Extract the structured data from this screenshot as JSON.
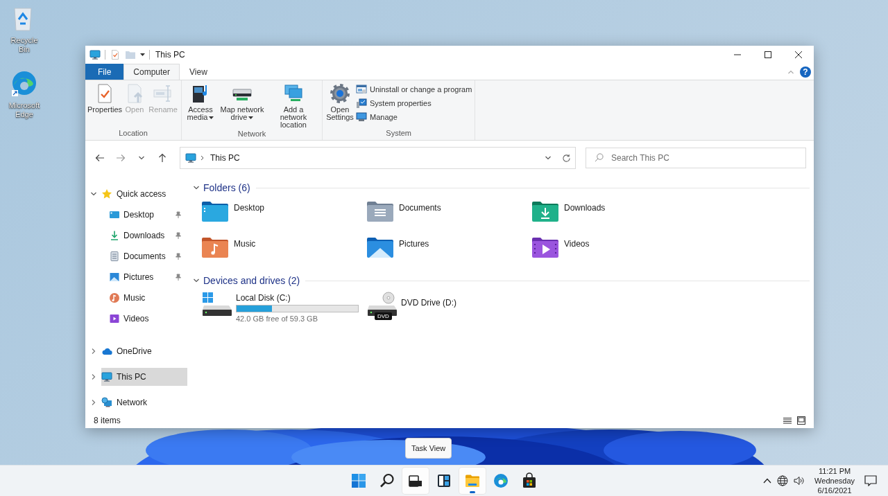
{
  "desktop_icons": [
    {
      "kind": "recycle_bin",
      "label": "Recycle Bin"
    },
    {
      "kind": "edge",
      "label": "Microsoft Edge"
    }
  ],
  "window": {
    "title": "This PC",
    "help": "?",
    "ribbon_tabs": [
      {
        "label": "File",
        "kind": "file",
        "selected": false
      },
      {
        "label": "Computer",
        "kind": "tab",
        "selected": true
      },
      {
        "label": "View",
        "kind": "tab",
        "selected": false
      }
    ],
    "ribbon_groups": [
      {
        "label": "Location",
        "buttons": [
          {
            "label": "Properties",
            "kind": "properties",
            "disabled": false,
            "dropdown": false
          },
          {
            "label": "Open",
            "kind": "open",
            "disabled": true,
            "dropdown": false
          },
          {
            "label": "Rename",
            "kind": "rename",
            "disabled": true,
            "dropdown": false
          }
        ]
      },
      {
        "label": "Network",
        "buttons": [
          {
            "label": "Access media",
            "kind": "media",
            "disabled": false,
            "dropdown": true
          },
          {
            "label": "Map network drive",
            "kind": "map_drive",
            "disabled": false,
            "dropdown": true
          },
          {
            "label": "Add a network location",
            "kind": "net_location",
            "disabled": false,
            "dropdown": false
          }
        ]
      },
      {
        "label": "System",
        "buttons": [
          {
            "label": "Open Settings",
            "kind": "settings",
            "disabled": false,
            "dropdown": false
          }
        ],
        "small_buttons": [
          {
            "label": "Uninstall or change a program",
            "kind": "uninstall"
          },
          {
            "label": "System properties",
            "kind": "sysprops"
          },
          {
            "label": "Manage",
            "kind": "manage"
          }
        ]
      }
    ],
    "address": {
      "path": [
        "This PC"
      ]
    },
    "search": {
      "placeholder": "Search This PC"
    },
    "navigation": [
      {
        "label": "Quick access",
        "kind": "star",
        "expanded": true,
        "selected": false,
        "children": [
          {
            "label": "Desktop",
            "kind": "desktop",
            "pinned": true,
            "selected": false
          },
          {
            "label": "Downloads",
            "kind": "downloads",
            "pinned": true,
            "selected": false
          },
          {
            "label": "Documents",
            "kind": "documents",
            "pinned": true,
            "selected": false
          },
          {
            "label": "Pictures",
            "kind": "pictures",
            "pinned": true,
            "selected": false
          },
          {
            "label": "Music",
            "kind": "music",
            "pinned": false,
            "selected": false
          },
          {
            "label": "Videos",
            "kind": "videos",
            "pinned": false,
            "selected": false
          }
        ]
      },
      {
        "label": "OneDrive",
        "kind": "cloud",
        "expanded": false,
        "selected": false
      },
      {
        "label": "This PC",
        "kind": "pc",
        "expanded": false,
        "selected": true
      },
      {
        "label": "Network",
        "kind": "network",
        "expanded": false,
        "selected": false
      }
    ],
    "sections": [
      {
        "title": "Folders (6)",
        "kind": "folders",
        "expanded": true,
        "items": [
          {
            "label": "Desktop",
            "kind": "desktop"
          },
          {
            "label": "Documents",
            "kind": "documents"
          },
          {
            "label": "Downloads",
            "kind": "downloads"
          },
          {
            "label": "Music",
            "kind": "music"
          },
          {
            "label": "Pictures",
            "kind": "pictures"
          },
          {
            "label": "Videos",
            "kind": "videos"
          }
        ]
      },
      {
        "title": "Devices and drives (2)",
        "kind": "drives",
        "expanded": true,
        "items": [
          {
            "label": "Local Disk (C:)",
            "kind": "system_drive",
            "level": 0.29,
            "detail": "42.0 GB free of 59.3 GB"
          },
          {
            "label": "DVD Drive (D:)",
            "kind": "dvd",
            "badge": "DVD"
          }
        ]
      }
    ],
    "status_bar": {
      "text": "8 items"
    }
  },
  "tooltip": "Task View",
  "taskbar": {
    "apps": [
      {
        "kind": "start",
        "highlighted": false,
        "running": false
      },
      {
        "kind": "search",
        "highlighted": false,
        "running": false
      },
      {
        "kind": "task_view",
        "highlighted": true,
        "running": false
      },
      {
        "kind": "widgets",
        "highlighted": false,
        "running": false
      },
      {
        "kind": "explorer",
        "highlighted": true,
        "running": true
      },
      {
        "kind": "edge",
        "highlighted": false,
        "running": false
      },
      {
        "kind": "store",
        "highlighted": false,
        "running": false
      }
    ],
    "clock": {
      "time": "11:21 PM",
      "day": "Wednesday",
      "date": "6/16/2021"
    }
  }
}
